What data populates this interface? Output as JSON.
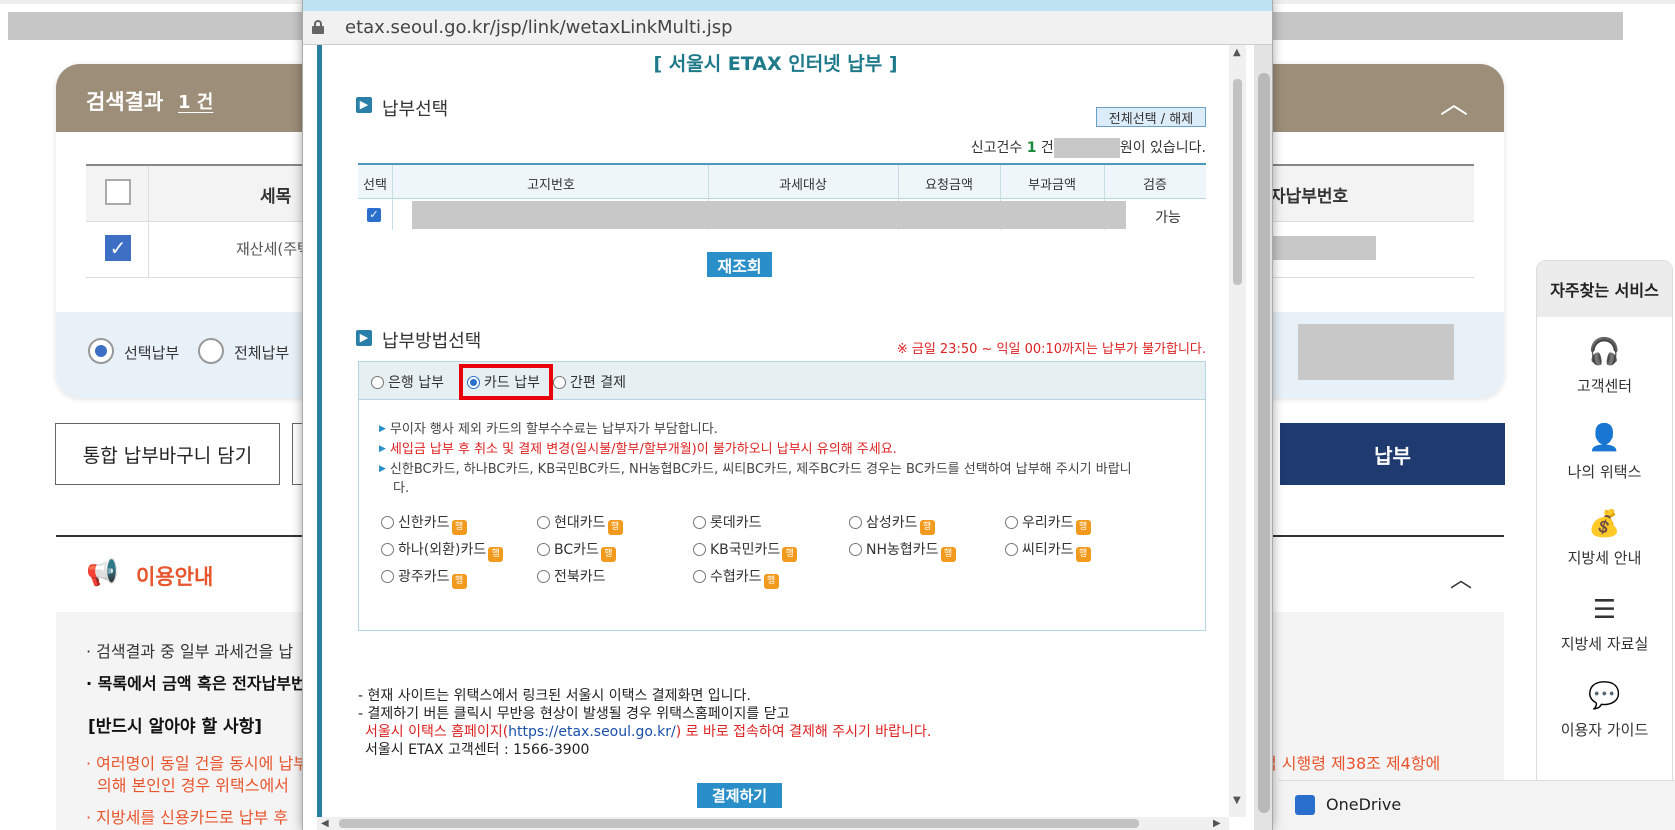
{
  "background_page": {
    "result_title": "검색결과",
    "result_count": "1 건",
    "table_headers": {
      "tax_item": "세목",
      "e_pay_number": "자납부번호"
    },
    "row": {
      "tax_item": "재산세(주택"
    },
    "options": {
      "selected_pay": "선택납부",
      "all_pay": "전체납부"
    },
    "buttons": {
      "cart": "통합 납부바구니 담기",
      "pay": "납부"
    },
    "guide": {
      "title": "이용안내",
      "line1": "검색결과 중 일부 과세건을 납",
      "line2": "목록에서 금액 혹은 전자납부번",
      "heading": "[반드시 알아야 할 사항]",
      "orange1a": "여러명이 동일 건을 동시에 납부",
      "orange1b": "의해 본인인 경우 위택스에서",
      "orange1_right": "법 시행령 제38조 제4항에",
      "orange2": "지방세를 신용카드로 납부 후"
    }
  },
  "quick_menu": {
    "title": "자주찾는 서비스",
    "items": [
      {
        "label": "고객센터",
        "icon": "headset-icon"
      },
      {
        "label": "나의 위택스",
        "icon": "person-icon"
      },
      {
        "label": "지방세 안내",
        "icon": "money-bag-icon"
      },
      {
        "label": "지방세 자료실",
        "icon": "list-icon"
      },
      {
        "label": "이용자 가이드",
        "icon": "chat-icon"
      }
    ]
  },
  "onedrive": {
    "label": "OneDrive"
  },
  "popup": {
    "url": "etax.seoul.go.kr/jsp/link/wetaxLinkMulti.jsp",
    "title": "[ 서울시 ETAX 인터넷 납부 ]",
    "section_select": "납부선택",
    "select_all_button": "전체선택 / 해제",
    "count_prefix": "신고건수",
    "count_value": "1",
    "count_unit": "건",
    "count_suffix": "원이 있습니다.",
    "table_headers": [
      "선택",
      "고지번호",
      "과세대상",
      "요청금액",
      "부과금액",
      "검증"
    ],
    "row_status": "가능",
    "requery_button": "재조회",
    "section_method": "납부방법선택",
    "time_warning": "※ 금일 23:50 ~ 익일 00:10까지는 납부가 불가합니다.",
    "methods": [
      "은행 납부",
      "카드 납부",
      "간편 결제"
    ],
    "selected_method": "카드 납부",
    "notices": [
      "무이자 행사 제외 카드의 할부수수료는 납부자가 부담합니다.",
      "세입금 납부 후 취소 및 결제 변경(일시불/할부/할부개월)이 불가하오니 납부시 유의해 주세요.",
      "신한BC카드, 하나BC카드, KB국민BC카드, NH농협BC카드, 씨티BC카드, 제주BC카드 경우는 BC카드를 선택하여 납부해 주시기 바랍니",
      "다."
    ],
    "cards": [
      {
        "name": "신한카드",
        "tag": "행"
      },
      {
        "name": "현대카드",
        "tag": "행"
      },
      {
        "name": "롯데카드",
        "tag": ""
      },
      {
        "name": "삼성카드",
        "tag": "행"
      },
      {
        "name": "우리카드",
        "tag": "행"
      },
      {
        "name": "하나(외환)카드",
        "tag": "행"
      },
      {
        "name": "BC카드",
        "tag": "행"
      },
      {
        "name": "KB국민카드",
        "tag": "행"
      },
      {
        "name": "NH농협카드",
        "tag": "행"
      },
      {
        "name": "씨티카드",
        "tag": "행"
      },
      {
        "name": "광주카드",
        "tag": "행"
      },
      {
        "name": "전북카드",
        "tag": ""
      },
      {
        "name": "수협카드",
        "tag": "행"
      }
    ],
    "footer": {
      "line1": "- 현재 사이트는 위택스에서 링크된 서울시 이택스 결제화면 입니다.",
      "line2": "- 결제하기 버튼 클릭시 무반응 현상이 발생될 경우 위택스홈페이지를 닫고",
      "line3a": "서울시 이택스 홈페이지(",
      "line3_link": "https://etax.seoul.go.kr/",
      "line3b": ") 로 바로 접속하여 결제해 주시기 바랍니다.",
      "line4": "서울시 ETAX 고객센터 : 1566-3900"
    },
    "pay_button": "결제하기"
  },
  "colors": {
    "header_brown": "#9c8e78",
    "navy": "#1e3a6e",
    "accent_blue": "#2a8fc8",
    "warning_red": "#d22222",
    "highlight_red": "#e8000a"
  }
}
